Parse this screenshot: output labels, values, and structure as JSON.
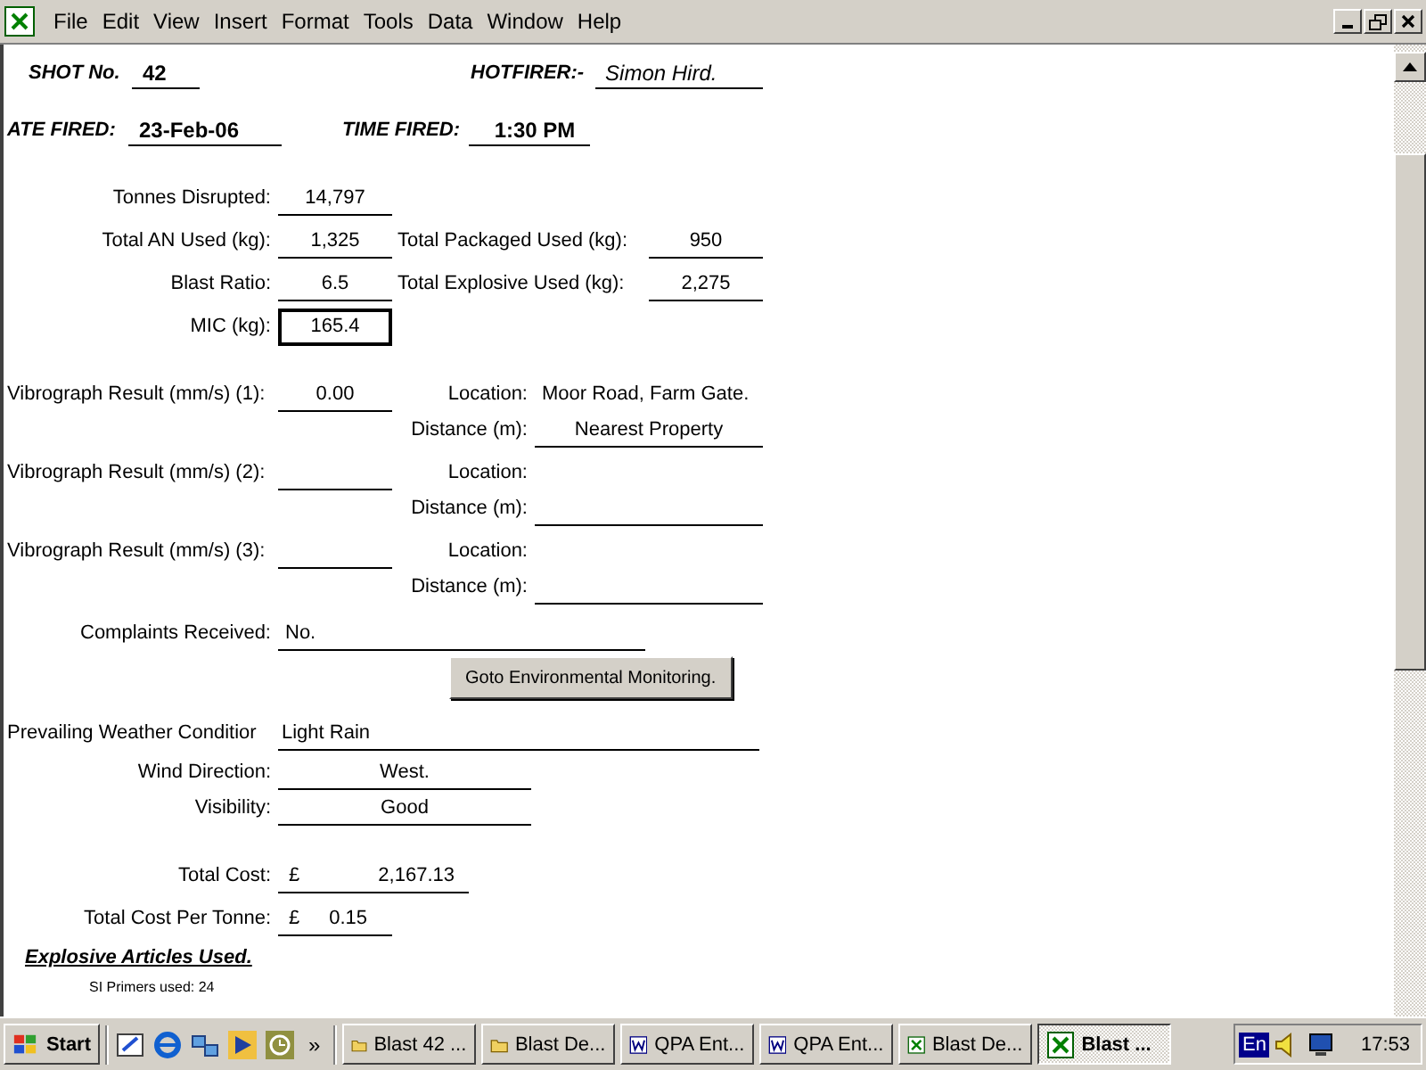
{
  "menu": [
    "File",
    "Edit",
    "View",
    "Insert",
    "Format",
    "Tools",
    "Data",
    "Window",
    "Help"
  ],
  "header": {
    "shot": {
      "label": "SHOT No.",
      "value": "42"
    },
    "shotfirer": {
      "label": "HOTFIRER:-",
      "value": "Simon Hird."
    },
    "date": {
      "label": "ATE FIRED:",
      "value": "23-Feb-06"
    },
    "time": {
      "label": "TIME FIRED:",
      "value": "1:30 PM"
    }
  },
  "quantities": [
    {
      "label": "Tonnes Disrupted:",
      "value": "14,797",
      "selected": false
    },
    {
      "label": "Total AN Used (kg):",
      "value": "1,325",
      "label_2": "Total Packaged Used (kg):",
      "value_2": "950",
      "selected": false
    },
    {
      "label": "Blast Ratio:",
      "value": "6.5",
      "label_2": "Total Explosive Used (kg):",
      "value_2": "2,275",
      "selected": false
    },
    {
      "label": "MIC (kg):",
      "value": "165.4",
      "selected": true
    }
  ],
  "vibrographs": [
    {
      "label": "Vibrograph Result (mm/s) (1):",
      "value": "0.00",
      "location_label": "Location:",
      "location": "Moor Road, Farm Gate.",
      "distance_label": "Distance (m):",
      "distance": "Nearest Property"
    },
    {
      "label": "Vibrograph Result (mm/s) (2):",
      "location_label": "Location:",
      "distance_label": "Distance (m):"
    },
    {
      "label": "Vibrograph Result (mm/s) (3):",
      "location_label": "Location:",
      "distance_label": "Distance (m):"
    }
  ],
  "complaints": {
    "label": "Complaints Received:",
    "value": "No."
  },
  "button": "Goto Environmental Monitoring.",
  "weather": {
    "label": "Prevailing Weather Conditior",
    "value": "Light Rain"
  },
  "conditions": [
    {
      "label": "Wind Direction:",
      "value": "West."
    },
    {
      "label": "Visibility:",
      "value": "Good"
    }
  ],
  "costs": [
    {
      "label": "Total Cost:",
      "currency": "£",
      "value": "2,167.13"
    },
    {
      "label": "Total Cost Per Tonne:",
      "currency": "£",
      "value": "0.15"
    }
  ],
  "articles_heading": "Explosive Articles Used.",
  "articles_partial": "SI Primers used: 24",
  "taskbar": {
    "start": "Start",
    "more": "»",
    "tasks": [
      {
        "label": "Blast 42 ...",
        "kind": "folder",
        "selected": false
      },
      {
        "label": "Blast De...",
        "kind": "folder",
        "selected": false
      },
      {
        "label": "QPA Ent...",
        "kind": "word",
        "selected": false
      },
      {
        "label": "QPA Ent...",
        "kind": "word",
        "selected": false
      },
      {
        "label": "Blast De...",
        "kind": "excel",
        "selected": false
      },
      {
        "label": "Blast ...",
        "kind": "excel",
        "selected": true
      }
    ],
    "language": "En",
    "clock": "17:53"
  }
}
